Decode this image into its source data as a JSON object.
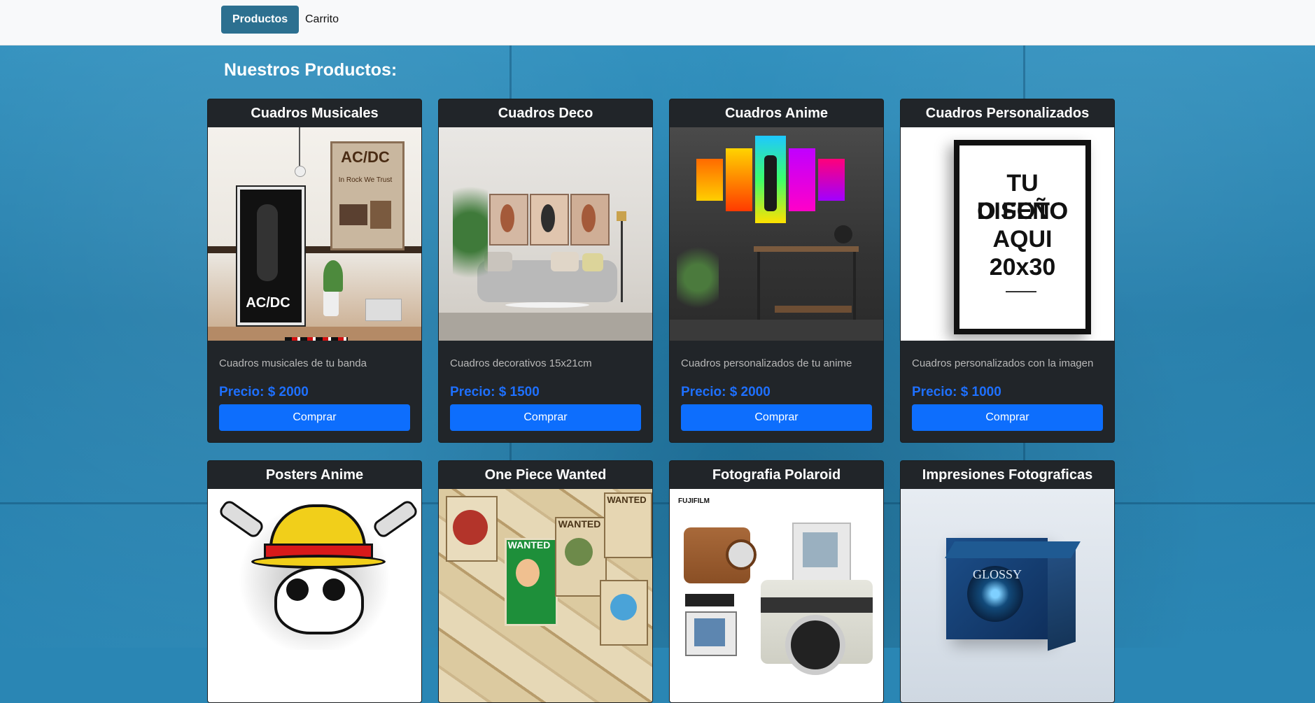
{
  "nav": {
    "products_label": "Productos",
    "cart_label": "Carrito"
  },
  "page": {
    "heading": "Nuestros Productos:"
  },
  "price_prefix": "Precio: $",
  "buy_label": "Comprar",
  "products": [
    {
      "title": "Cuadros Musicales",
      "description": "Cuadros musicales de tu banda",
      "price": "2000"
    },
    {
      "title": "Cuadros Deco",
      "description": "Cuadros decorativos 15x21cm",
      "price": "1500"
    },
    {
      "title": "Cuadros Anime",
      "description": "Cuadros personalizados de tu anime",
      "price": "2000"
    },
    {
      "title": "Cuadros Personalizados",
      "description": "Cuadros personalizados con la imagen",
      "price": "1000"
    },
    {
      "title": "Posters Anime"
    },
    {
      "title": "One Piece Wanted"
    },
    {
      "title": "Fotografia Polaroid"
    },
    {
      "title": "Impresiones Fotograficas"
    }
  ],
  "image_text": {
    "acdc": "AC/DC",
    "acdc_tagline": "In Rock We Trust",
    "custom_line1": "TU DISEÑO",
    "custom_line2": "O FOTO",
    "custom_line3": "AQUI",
    "custom_line4": "20x30",
    "wanted": "WANTED",
    "fujifilm": "FUJIFILM",
    "glossy": "GLOSSY"
  },
  "colors": {
    "navbar_bg": "#f8f9fa",
    "nav_active_bg": "#2c7090",
    "card_bg": "#212529",
    "price_color": "#1e70ff",
    "button_bg": "#0d6efd",
    "page_bg": "#2a86b4"
  }
}
